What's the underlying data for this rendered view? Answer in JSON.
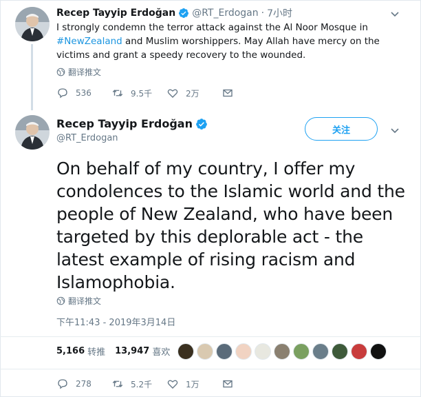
{
  "tweet_reply": {
    "name": "Recep Tayyip Erdoğan",
    "handle": "@RT_Erdogan",
    "separator": "·",
    "time": "7小时",
    "text_before": "I strongly condemn the terror attack against the Al Noor Mosque in ",
    "hashtag": "#NewZealand",
    "text_after": " and Muslim worshippers. May Allah have mercy on the victims and grant a speedy recovery to the wounded.",
    "translate_label": "翻译推文",
    "reply_count": "536",
    "retweet_count": "9.5千",
    "like_count": "2万"
  },
  "tweet_main": {
    "name": "Recep Tayyip Erdoğan",
    "handle": "@RT_Erdogan",
    "follow_label": "关注",
    "text": "On behalf of my country, I offer my condolences to the Islamic world and the people of New Zealand, who have been targeted by this deplorable act - the latest example of rising racism and Islamophobia.",
    "translate_label": "翻译推文",
    "timestamp": "下午11:43 - 2019年3月14日",
    "retweets_num": "5,166",
    "retweets_label": "转推",
    "likes_num": "13,947",
    "likes_label": "喜欢",
    "reply_count": "278",
    "retweet_count": "5.2千",
    "like_count": "1万"
  },
  "colors": {
    "accent": "#1da1f2",
    "link": "#1b95e0",
    "muted": "#657786",
    "text": "#14171a",
    "thread_line": "#d2dde6"
  },
  "icons": [
    "verified-badge-icon",
    "chevron-down-icon",
    "globe-icon",
    "reply-icon",
    "retweet-icon",
    "like-icon",
    "message-icon"
  ]
}
